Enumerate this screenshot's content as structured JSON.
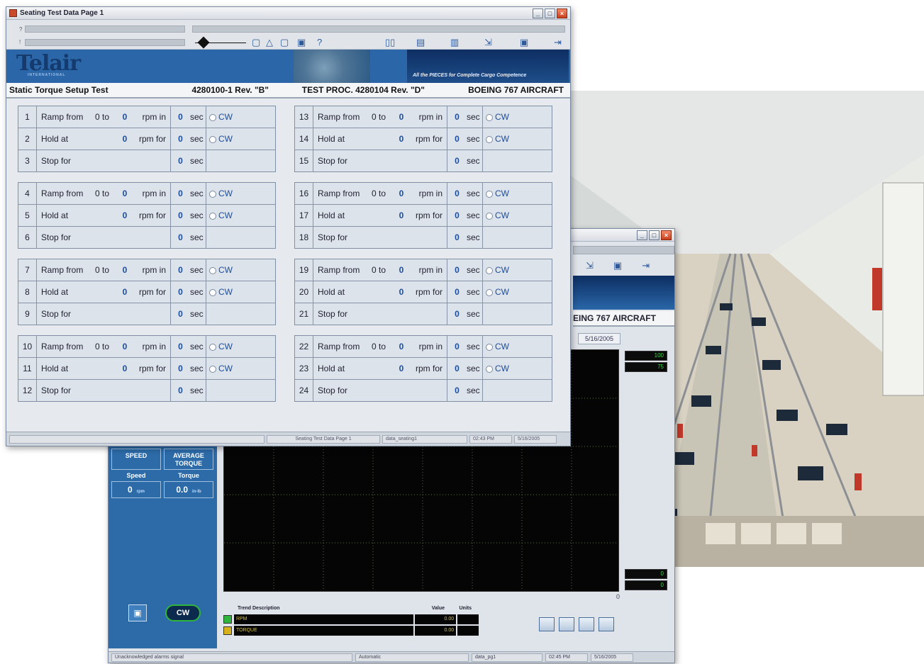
{
  "front": {
    "title": "Seating Test Data Page 1",
    "window_buttons": [
      "_",
      "□",
      "×"
    ],
    "toolbar": {
      "row_labels": [
        "?",
        "!"
      ],
      "help": "?"
    },
    "logo": "Telair",
    "logo_sub": "INTERNATIONAL",
    "slogan": "All the PIECES for Complete Cargo Competence",
    "heading": {
      "test_name": "Static Torque Setup Test",
      "part": "4280100-1 Rev. \"B\"",
      "proc": "TEST PROC. 4280104 Rev. \"D\"",
      "aircraft": "BOEING 767 AIRCRAFT"
    },
    "labels": {
      "ramp": "Ramp from",
      "hold": "Hold at",
      "stop": "Stop for",
      "zero_to": "0 to",
      "rpm_in": "rpm in",
      "rpm_for": "rpm for",
      "sec": "sec",
      "cw": "CW"
    },
    "groups": [
      {
        "ramp": {
          "n": "1",
          "rpm": "0",
          "t": "0"
        },
        "hold": {
          "n": "2",
          "rpm": "0",
          "t": "0"
        },
        "stop": {
          "n": "3",
          "t": "0"
        }
      },
      {
        "ramp": {
          "n": "4",
          "rpm": "0",
          "t": "0"
        },
        "hold": {
          "n": "5",
          "rpm": "0",
          "t": "0"
        },
        "stop": {
          "n": "6",
          "t": "0"
        }
      },
      {
        "ramp": {
          "n": "7",
          "rpm": "0",
          "t": "0"
        },
        "hold": {
          "n": "8",
          "rpm": "0",
          "t": "0"
        },
        "stop": {
          "n": "9",
          "t": "0"
        }
      },
      {
        "ramp": {
          "n": "10",
          "rpm": "0",
          "t": "0"
        },
        "hold": {
          "n": "11",
          "rpm": "0",
          "t": "0"
        },
        "stop": {
          "n": "12",
          "t": "0"
        }
      },
      {
        "ramp": {
          "n": "13",
          "rpm": "0",
          "t": "0"
        },
        "hold": {
          "n": "14",
          "rpm": "0",
          "t": "0"
        },
        "stop": {
          "n": "15",
          "t": "0"
        }
      },
      {
        "ramp": {
          "n": "16",
          "rpm": "0",
          "t": "0"
        },
        "hold": {
          "n": "17",
          "rpm": "0",
          "t": "0"
        },
        "stop": {
          "n": "18",
          "t": "0"
        }
      },
      {
        "ramp": {
          "n": "19",
          "rpm": "0",
          "t": "0"
        },
        "hold": {
          "n": "20",
          "rpm": "0",
          "t": "0"
        },
        "stop": {
          "n": "21",
          "t": "0"
        }
      },
      {
        "ramp": {
          "n": "22",
          "rpm": "0",
          "t": "0"
        },
        "hold": {
          "n": "23",
          "rpm": "0",
          "t": "0"
        },
        "stop": {
          "n": "24",
          "t": "0"
        }
      }
    ],
    "status": {
      "page": "Seating Test Data Page 1",
      "db": "data_seating1",
      "time": "02:43 PM",
      "date": "5/16/2005"
    }
  },
  "back": {
    "window_buttons": [
      "_",
      "□",
      "×"
    ],
    "aircraft": "EING 767 AIRCRAFT",
    "date": "5/16/2005",
    "right_readouts": [
      "100",
      "75",
      "0",
      "0"
    ],
    "axis_zero": "0",
    "gauges": {
      "speed_head": "SPEED",
      "torque_head": "AVERAGE TORQUE",
      "speed_label": "Speed",
      "torque_label": "Torque",
      "speed_value": "0",
      "speed_unit": "rpm",
      "torque_value": "0.0",
      "torque_unit": "in-lb"
    },
    "cw_badge": "CW",
    "trend": {
      "headers": [
        "Trend Description",
        "Value",
        "Units"
      ],
      "rows": [
        {
          "name": "RPM",
          "value": "0.00",
          "color": "#2fb43c"
        },
        {
          "name": "TORQUE",
          "value": "0.00",
          "color": "#d8b21c"
        }
      ]
    },
    "status": {
      "alarm": "Unacknowledged alarms signal",
      "mode": "Automatic",
      "db": "data_pg1",
      "time": "02:45 PM",
      "date": "5/16/2005"
    }
  },
  "colors": {
    "accent": "#2a66a8",
    "value_blue": "#1c4ea0",
    "trend_text": "#d8c236"
  }
}
